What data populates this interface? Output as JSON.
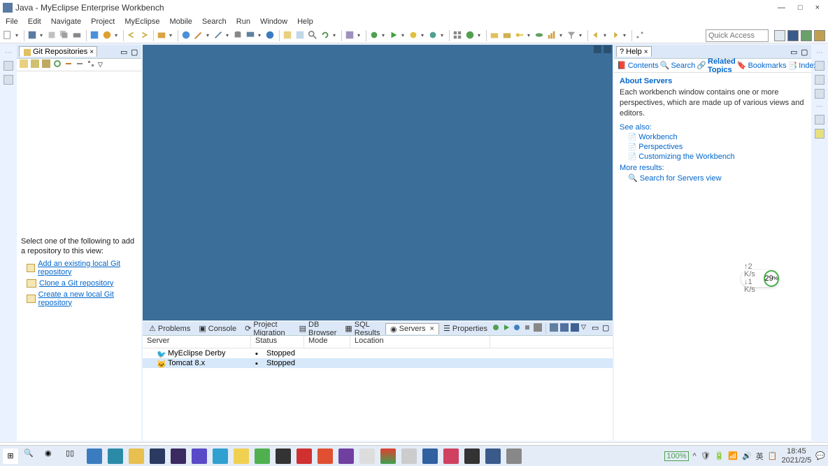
{
  "titlebar": {
    "title": "Java - MyEclipse Enterprise Workbench"
  },
  "menu": [
    "File",
    "Edit",
    "Navigate",
    "Project",
    "MyEclipse",
    "Mobile",
    "Search",
    "Run",
    "Window",
    "Help"
  ],
  "quick_access": {
    "placeholder": "Quick Access"
  },
  "git_view": {
    "title": "Git Repositories",
    "instruction": "Select one of the following to add a repository to this view:",
    "links": [
      "Add an existing local Git repository",
      "Clone a Git repository",
      "Create a new local Git repository"
    ]
  },
  "bottom_tabs": [
    "Problems",
    "Console",
    "Project Migration",
    "DB Browser",
    "SQL Results",
    "Servers",
    "Properties"
  ],
  "servers": {
    "columns": [
      "Server",
      "Status",
      "Mode",
      "Location"
    ],
    "rows": [
      {
        "name": "MyEclipse Derby",
        "status": "Stopped",
        "mode": "",
        "location": ""
      },
      {
        "name": "Tomcat  8.x",
        "status": "Stopped",
        "mode": "",
        "location": ""
      }
    ]
  },
  "help": {
    "title": "Help",
    "tabs": [
      "Contents",
      "Search",
      "Related Topics",
      "Bookmarks",
      "Index"
    ],
    "about": "About Servers",
    "text": "Each workbench window contains one or more perspectives, which are made up of various views and editors.",
    "see_also": "See also:",
    "see_links": [
      "Workbench",
      "Perspectives",
      "Customizing the Workbench"
    ],
    "more": "More results:",
    "more_link": "Search for Servers view"
  },
  "meter": {
    "up": "↑2 K/s",
    "down": "↓1 K/s",
    "pct": "29",
    "unit": "%"
  },
  "taskbar": {
    "battery": "100%",
    "time": "18:45",
    "date": "2021/2/5"
  },
  "icons": {
    "close": "×",
    "min": "—",
    "max": "□"
  }
}
